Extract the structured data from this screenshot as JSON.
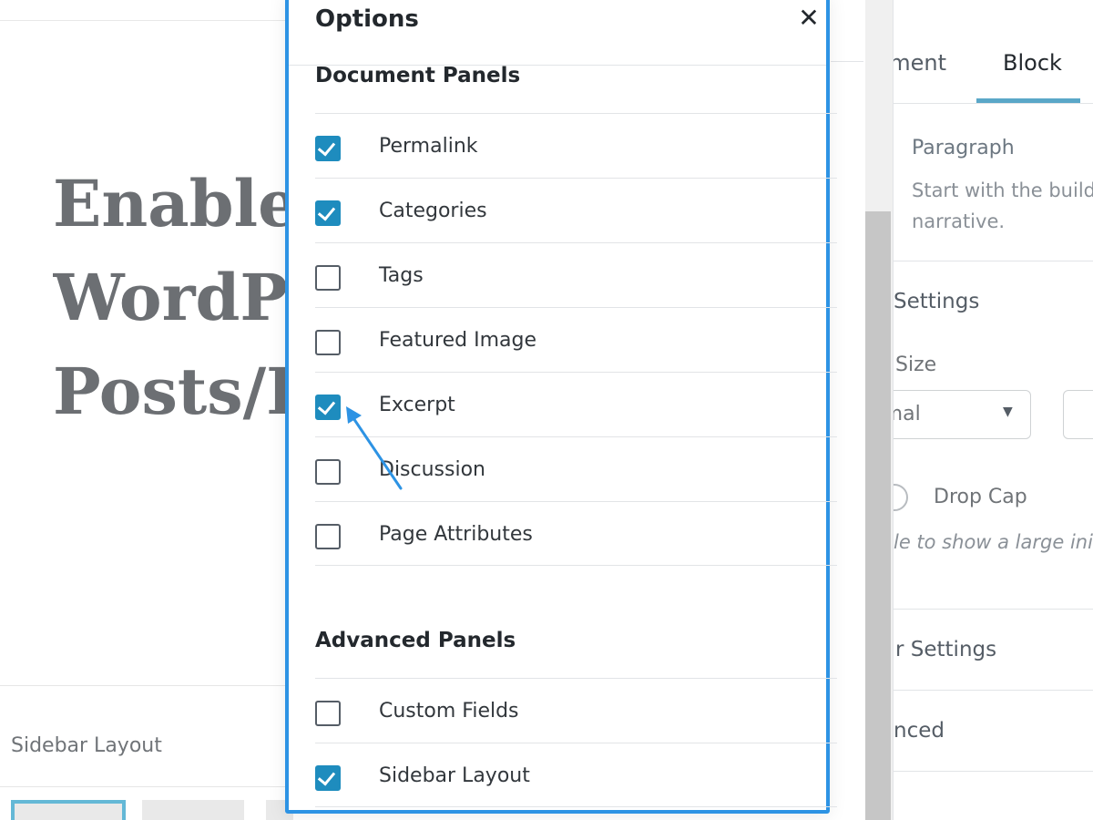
{
  "editor": {
    "post_title": "Enable\nWordPr\nPosts/P",
    "meta_box_title": "Sidebar Layout"
  },
  "sidebar": {
    "tabs": [
      {
        "label": "ument",
        "active": false
      },
      {
        "label": "Block",
        "active": true
      }
    ],
    "block_title": "Paragraph",
    "block_description": "Start with the build\nnarrative.",
    "section_text_settings": "Settings",
    "font_size_label": "Size",
    "font_size_select_value": "rmal",
    "drop_cap_label": "Drop Cap",
    "drop_cap_help": "le to show a large init",
    "section_color_settings": "r Settings",
    "section_advanced": "nced"
  },
  "modal": {
    "title": "Options",
    "close_icon": "close-icon",
    "document_panels_title": "Document Panels",
    "document_panels": [
      {
        "label": "Permalink",
        "checked": true
      },
      {
        "label": "Categories",
        "checked": true
      },
      {
        "label": "Tags",
        "checked": false
      },
      {
        "label": "Featured Image",
        "checked": false
      },
      {
        "label": "Excerpt",
        "checked": true
      },
      {
        "label": "Discussion",
        "checked": false
      },
      {
        "label": "Page Attributes",
        "checked": false
      }
    ],
    "advanced_panels_title": "Advanced Panels",
    "advanced_panels": [
      {
        "label": "Custom Fields",
        "checked": false
      },
      {
        "label": "Sidebar Layout",
        "checked": true
      }
    ]
  },
  "colors": {
    "modal_border": "#2d93e4",
    "checkbox_checked": "#1e8cbe",
    "annotation_arrow": "#2d93e4",
    "tab_underline": "#5aa7c8"
  }
}
